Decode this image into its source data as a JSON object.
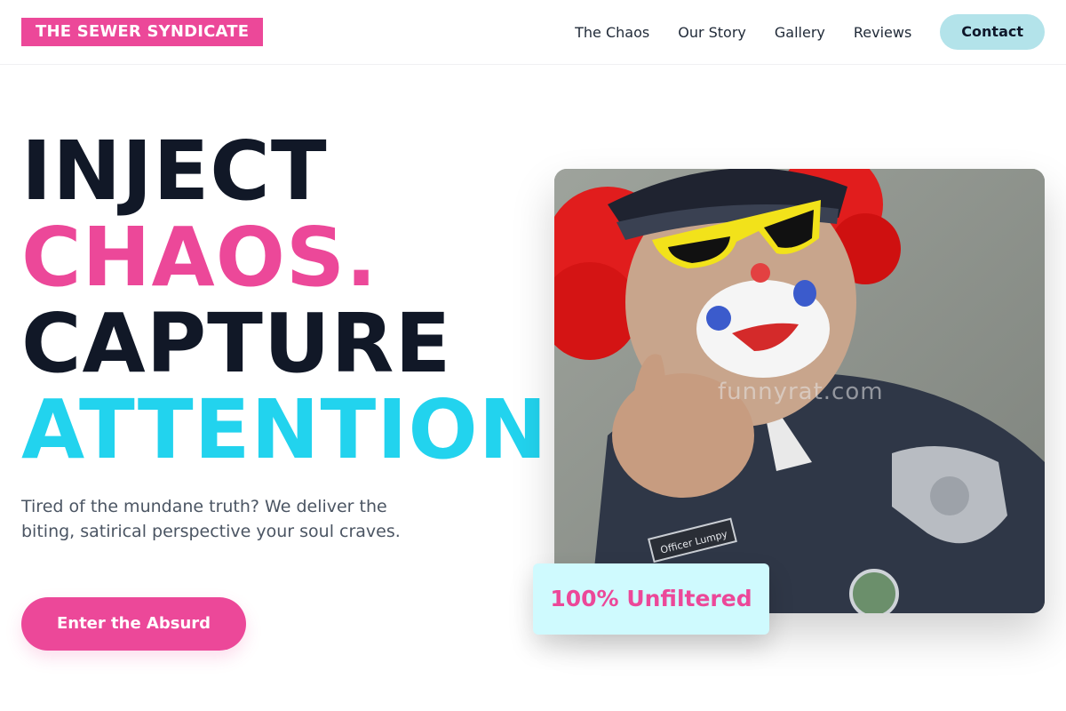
{
  "brand": {
    "name": "THE SEWER SYNDICATE"
  },
  "nav": {
    "links": [
      "The Chaos",
      "Our Story",
      "Gallery",
      "Reviews"
    ],
    "contact_label": "Contact"
  },
  "hero": {
    "line1": "INJECT",
    "line2": "CHAOS.",
    "line3": "CAPTURE",
    "line4": "ATTENTION.",
    "subtitle": "Tired of the mundane truth? We deliver the biting, satirical perspective your soul craves.",
    "cta_label": "Enter the Absurd"
  },
  "photo": {
    "watermark": "funnyrat.com",
    "name_tag": "Officer Lumpy"
  },
  "badge": {
    "label": "100% Unfiltered"
  },
  "colors": {
    "accent_pink": "#ec4899",
    "accent_cyan": "#22d3ee",
    "contact_bg": "#b3e3ea",
    "badge_bg": "#cffafe"
  }
}
